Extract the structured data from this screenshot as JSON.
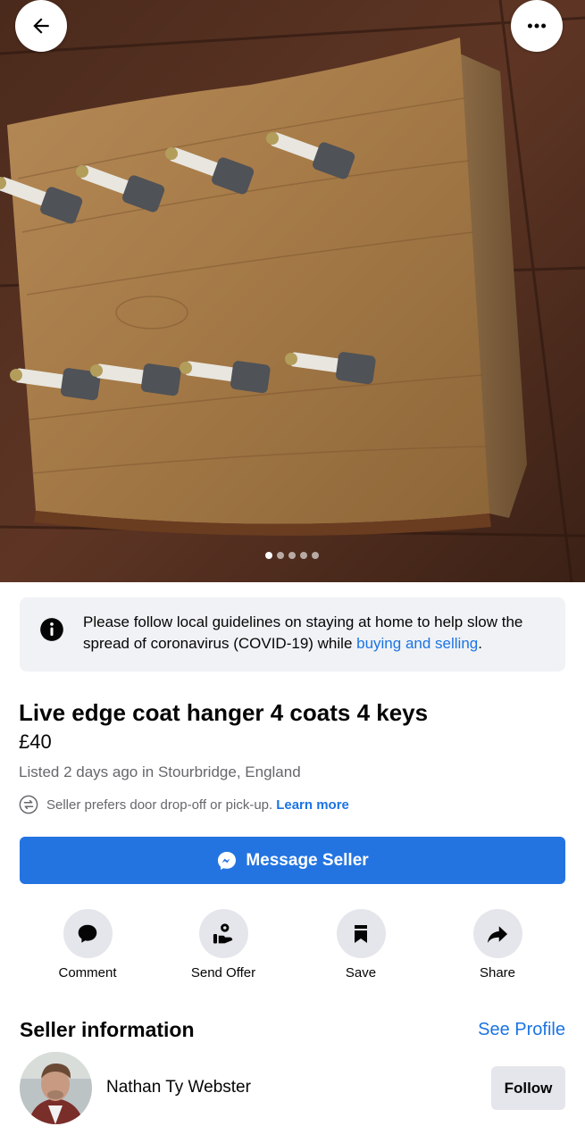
{
  "header": {
    "back_icon": "arrow-left-icon",
    "more_icon": "more-horizontal-icon",
    "photo_count": 5,
    "active_photo": 1
  },
  "notice": {
    "icon": "info-icon",
    "text": "Please follow local guidelines on staying at home to help slow the spread of coronavirus (COVID-19) while ",
    "link_text": "buying and selling",
    "end": "."
  },
  "listing": {
    "title": "Live edge coat hanger 4 coats 4 keys",
    "price": "£40",
    "listed": "Listed 2 days ago in Stourbridge, England",
    "delivery_text": "Seller prefers door drop-off or pick-up.",
    "learn_more": "Learn more"
  },
  "message_button": {
    "label": "Message Seller",
    "icon": "messenger-icon"
  },
  "actions": [
    {
      "label": "Comment",
      "icon": "comment-icon"
    },
    {
      "label": "Send Offer",
      "icon": "send-offer-icon"
    },
    {
      "label": "Save",
      "icon": "bookmark-icon"
    },
    {
      "label": "Share",
      "icon": "share-icon"
    }
  ],
  "seller": {
    "heading": "Seller information",
    "see_profile": "See Profile",
    "name": "Nathan Ty Webster",
    "follow": "Follow"
  },
  "colors": {
    "accent": "#1b74e4",
    "button_blue": "#2374e1",
    "grey_button": "#e4e6eb",
    "notice_bg": "#f0f2f5"
  }
}
